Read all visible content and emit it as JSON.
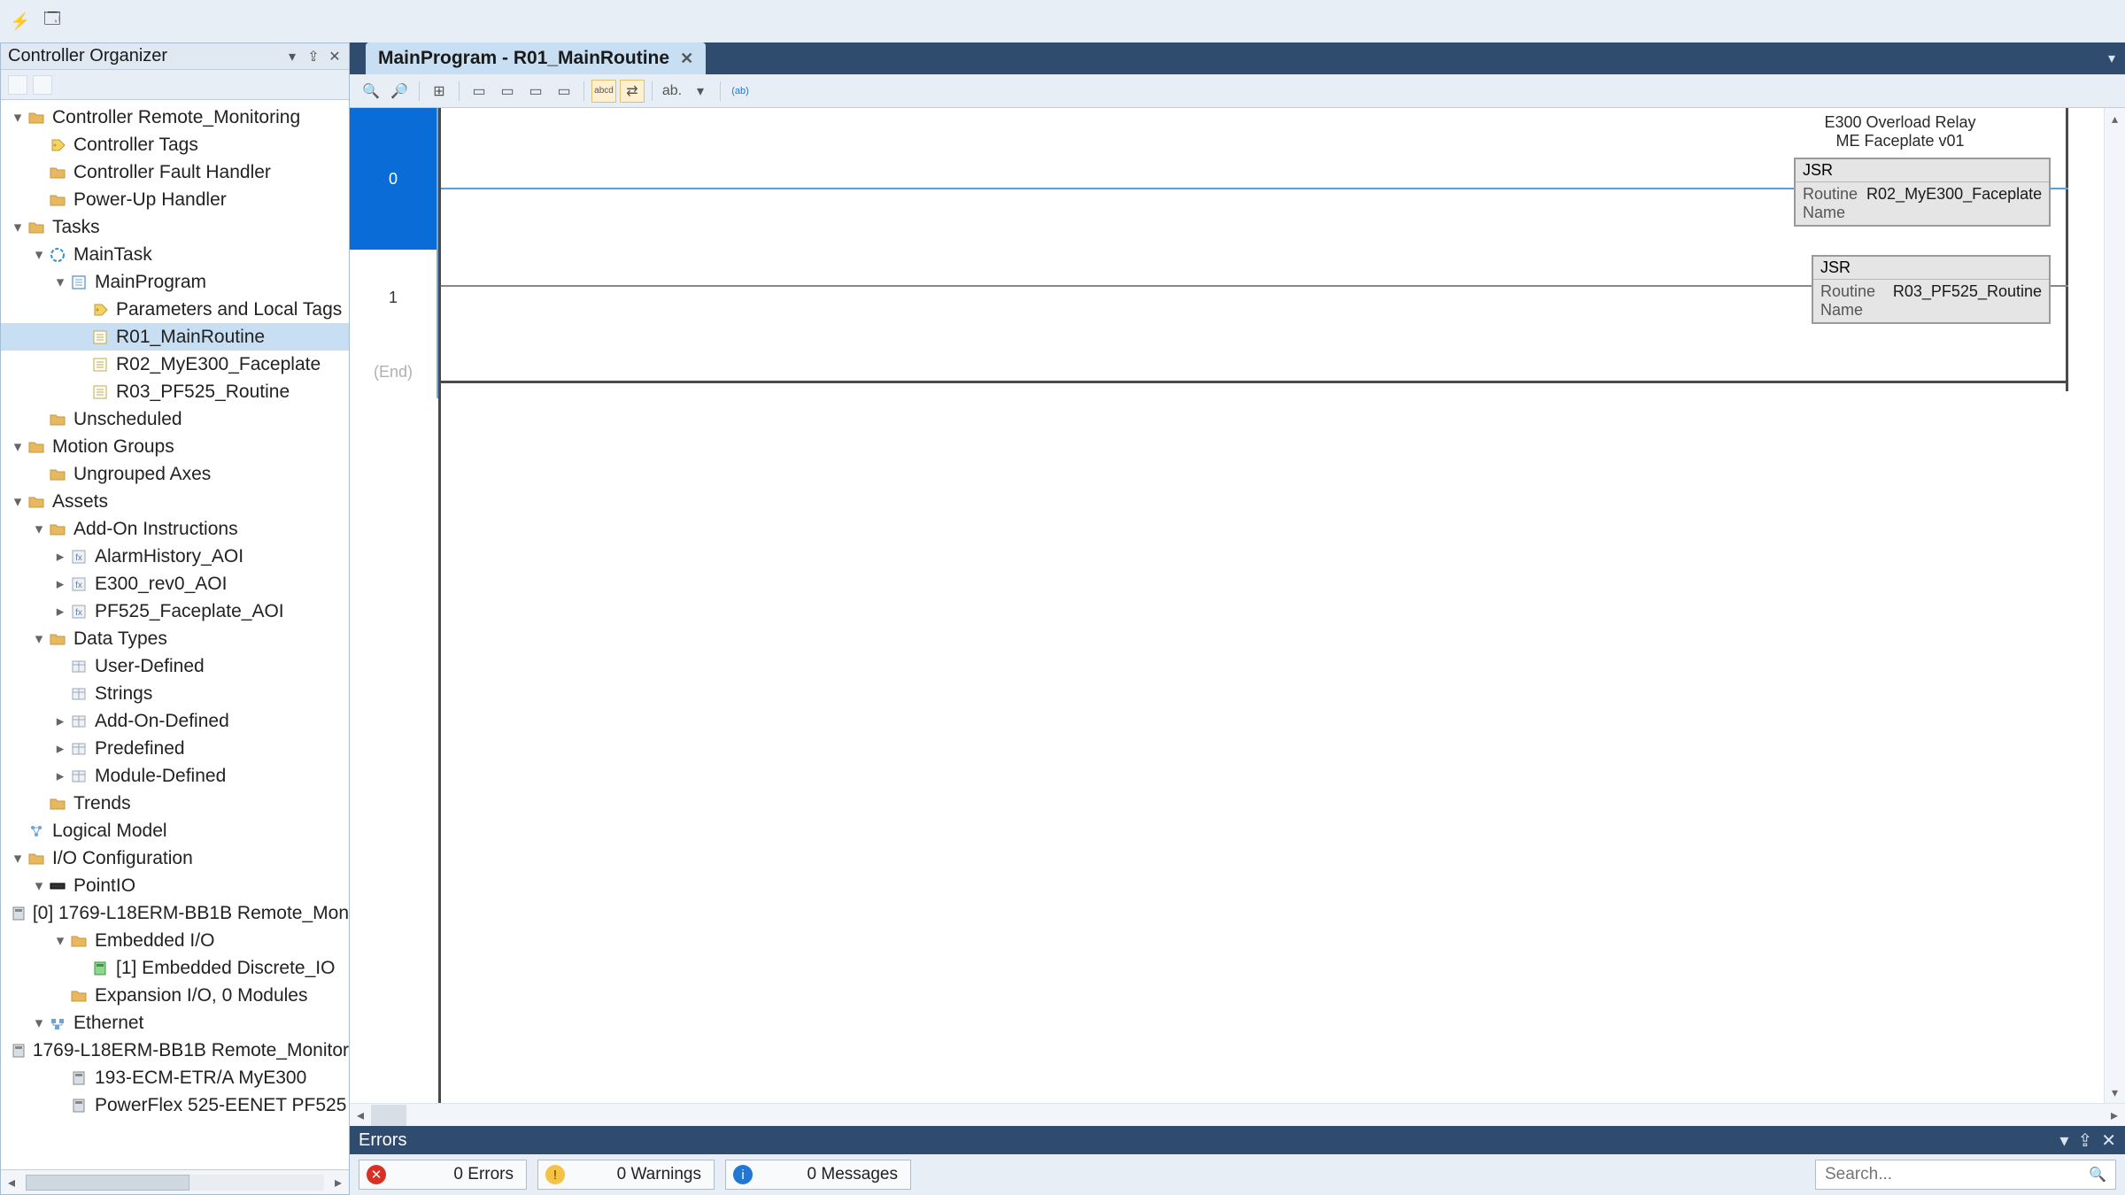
{
  "organizer": {
    "title": "Controller Organizer",
    "tree": [
      {
        "d": 0,
        "tw": "▾",
        "icon": "controller",
        "label": "Controller Remote_Monitoring"
      },
      {
        "d": 1,
        "tw": "",
        "icon": "tag",
        "label": "Controller Tags"
      },
      {
        "d": 1,
        "tw": "",
        "icon": "folder",
        "label": "Controller Fault Handler"
      },
      {
        "d": 1,
        "tw": "",
        "icon": "folder",
        "label": "Power-Up Handler"
      },
      {
        "d": 0,
        "tw": "▾",
        "icon": "folder",
        "label": "Tasks"
      },
      {
        "d": 1,
        "tw": "▾",
        "icon": "task",
        "label": "MainTask"
      },
      {
        "d": 2,
        "tw": "▾",
        "icon": "program",
        "label": "MainProgram"
      },
      {
        "d": 3,
        "tw": "",
        "icon": "tag",
        "label": "Parameters and Local Tags"
      },
      {
        "d": 3,
        "tw": "",
        "icon": "routine",
        "label": "R01_MainRoutine",
        "selected": true
      },
      {
        "d": 3,
        "tw": "",
        "icon": "routine",
        "label": "R02_MyE300_Faceplate"
      },
      {
        "d": 3,
        "tw": "",
        "icon": "routine",
        "label": "R03_PF525_Routine"
      },
      {
        "d": 1,
        "tw": "",
        "icon": "folder",
        "label": "Unscheduled"
      },
      {
        "d": 0,
        "tw": "▾",
        "icon": "folder",
        "label": "Motion Groups"
      },
      {
        "d": 1,
        "tw": "",
        "icon": "folder",
        "label": "Ungrouped Axes"
      },
      {
        "d": 0,
        "tw": "▾",
        "icon": "folder",
        "label": "Assets"
      },
      {
        "d": 1,
        "tw": "▾",
        "icon": "folder",
        "label": "Add-On Instructions"
      },
      {
        "d": 2,
        "tw": "▸",
        "icon": "aoi",
        "label": "AlarmHistory_AOI"
      },
      {
        "d": 2,
        "tw": "▸",
        "icon": "aoi",
        "label": "E300_rev0_AOI"
      },
      {
        "d": 2,
        "tw": "▸",
        "icon": "aoi",
        "label": "PF525_Faceplate_AOI"
      },
      {
        "d": 1,
        "tw": "▾",
        "icon": "folder",
        "label": "Data Types"
      },
      {
        "d": 2,
        "tw": "",
        "icon": "datatype",
        "label": "User-Defined"
      },
      {
        "d": 2,
        "tw": "",
        "icon": "datatype",
        "label": "Strings"
      },
      {
        "d": 2,
        "tw": "▸",
        "icon": "datatype",
        "label": "Add-On-Defined"
      },
      {
        "d": 2,
        "tw": "▸",
        "icon": "datatype",
        "label": "Predefined"
      },
      {
        "d": 2,
        "tw": "▸",
        "icon": "datatype",
        "label": "Module-Defined"
      },
      {
        "d": 1,
        "tw": "",
        "icon": "folder",
        "label": "Trends"
      },
      {
        "d": 0,
        "tw": "",
        "icon": "logical",
        "label": "Logical Model"
      },
      {
        "d": 0,
        "tw": "▾",
        "icon": "folder",
        "label": "I/O Configuration"
      },
      {
        "d": 1,
        "tw": "▾",
        "icon": "bus",
        "label": "PointIO"
      },
      {
        "d": 2,
        "tw": "",
        "icon": "module",
        "label": "[0] 1769-L18ERM-BB1B Remote_Mon"
      },
      {
        "d": 2,
        "tw": "▾",
        "icon": "folder",
        "label": "Embedded I/O"
      },
      {
        "d": 3,
        "tw": "",
        "icon": "module-g",
        "label": "[1] Embedded Discrete_IO"
      },
      {
        "d": 2,
        "tw": "",
        "icon": "folder",
        "label": "Expansion I/O, 0 Modules"
      },
      {
        "d": 1,
        "tw": "▾",
        "icon": "ethernet",
        "label": "Ethernet"
      },
      {
        "d": 2,
        "tw": "",
        "icon": "module",
        "label": "1769-L18ERM-BB1B Remote_Monitor"
      },
      {
        "d": 2,
        "tw": "",
        "icon": "module",
        "label": "193-ECM-ETR/A MyE300"
      },
      {
        "d": 2,
        "tw": "",
        "icon": "module",
        "label": "PowerFlex 525-EENET PF525"
      }
    ]
  },
  "tab": {
    "title": "MainProgram - R01_MainRoutine"
  },
  "ladder": {
    "rung0": {
      "num": "0",
      "desc_l1": "E300 Overload Relay",
      "desc_l2": "ME Faceplate v01",
      "jsr_title": "JSR",
      "jsr_label": "Routine Name",
      "jsr_val": "R02_MyE300_Faceplate"
    },
    "rung1": {
      "num": "1",
      "jsr_title": "JSR",
      "jsr_label": "Routine Name",
      "jsr_val": "R03_PF525_Routine"
    },
    "end": "(End)"
  },
  "errors": {
    "title": "Errors",
    "errcount": "0 Errors",
    "warncount": "0 Warnings",
    "msgcount": "0 Messages",
    "search_ph": "Search..."
  }
}
